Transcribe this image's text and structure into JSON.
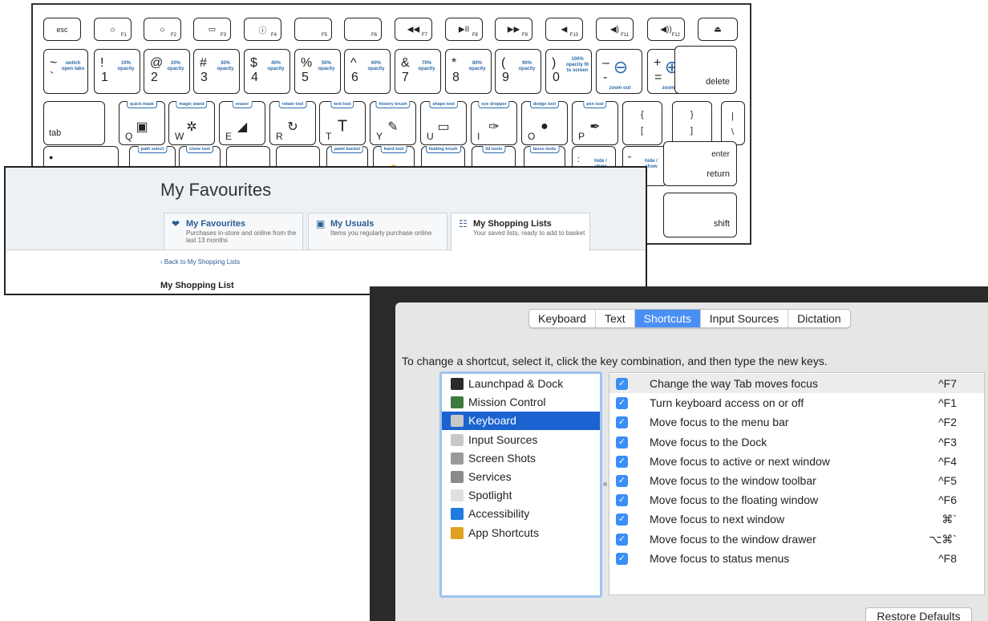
{
  "keyboard": {
    "row1": [
      {
        "label": "esc",
        "fn": ""
      },
      {
        "label": "☼",
        "fn": "F1"
      },
      {
        "label": "☼",
        "fn": "F2"
      },
      {
        "label": "▭",
        "fn": "F3"
      },
      {
        "label": "ⓘ",
        "fn": "F4"
      },
      {
        "label": "",
        "fn": "F5"
      },
      {
        "label": "",
        "fn": "F6"
      },
      {
        "label": "◀◀",
        "fn": "F7"
      },
      {
        "label": "▶II",
        "fn": "F8"
      },
      {
        "label": "▶▶",
        "fn": "F9"
      },
      {
        "label": "◀",
        "fn": "F10"
      },
      {
        "label": "◀)",
        "fn": "F11"
      },
      {
        "label": "◀))",
        "fn": "F12"
      },
      {
        "label": "⏏",
        "fn": ""
      }
    ],
    "row2": [
      {
        "sym": "~",
        "base": "`",
        "action": "switch open tabs"
      },
      {
        "sym": "!",
        "base": "1",
        "action": "10% opacity"
      },
      {
        "sym": "@",
        "base": "2",
        "action": "20% opacity"
      },
      {
        "sym": "#",
        "base": "3",
        "action": "30% opacity"
      },
      {
        "sym": "$",
        "base": "4",
        "action": "40% opacity"
      },
      {
        "sym": "%",
        "base": "5",
        "action": "50% opacity"
      },
      {
        "sym": "^",
        "base": "6",
        "action": "60% opacity"
      },
      {
        "sym": "&",
        "base": "7",
        "action": "70% opacity"
      },
      {
        "sym": "*",
        "base": "8",
        "action": "80% opacity"
      },
      {
        "sym": "(",
        "base": "9",
        "action": "90% opacity"
      },
      {
        "sym": ")",
        "base": "0",
        "action": "100% opacity fit to screen"
      },
      {
        "sym": "–",
        "base": "-",
        "action": "zoom out"
      },
      {
        "sym": "+",
        "base": "=",
        "action": "zoom in"
      },
      {
        "sym": "",
        "base": "delete",
        "action": ""
      }
    ],
    "row3": [
      {
        "base": "tab",
        "tool": ""
      },
      {
        "base": "Q",
        "tool": "quick mask"
      },
      {
        "base": "W",
        "tool": "magic wand"
      },
      {
        "base": "E",
        "tool": "eraser"
      },
      {
        "base": "R",
        "tool": "rotate tool"
      },
      {
        "base": "T",
        "tool": "text tool"
      },
      {
        "base": "Y",
        "tool": "history brush"
      },
      {
        "base": "U",
        "tool": "shape tool"
      },
      {
        "base": "I",
        "tool": "eye dropper"
      },
      {
        "base": "O",
        "tool": "dodge tool"
      },
      {
        "base": "P",
        "tool": "pen tool"
      },
      {
        "base": "{ [",
        "tool": ""
      },
      {
        "base": "} ]",
        "tool": ""
      },
      {
        "base": "| \\",
        "tool": ""
      }
    ],
    "row4": [
      {
        "base": "●",
        "tool": ""
      },
      {
        "base": "",
        "tool": "path select"
      },
      {
        "base": "",
        "tool": "clone tool"
      },
      {
        "base": "",
        "tool": ""
      },
      {
        "base": "",
        "tool": ""
      },
      {
        "base": "",
        "tool": "paint bucket"
      },
      {
        "base": "",
        "tool": "hand tool"
      },
      {
        "base": "",
        "tool": "healing brush"
      },
      {
        "base": "",
        "tool": "3d tools"
      },
      {
        "base": "",
        "tool": "lasso tools"
      },
      {
        "base": ":",
        "tool": "hide / show"
      },
      {
        "base": "\"",
        "tool": "hide / show"
      }
    ],
    "enter_top": "enter",
    "enter_bottom": "return",
    "shift": "shift"
  },
  "favourites": {
    "title": "My Favourites",
    "tabs": [
      {
        "title": "My Favourites",
        "subtitle": "Purchases in-store and online from the last 13 months",
        "icon": "heart-icon"
      },
      {
        "title": "My Usuals",
        "subtitle": "Items you regularly purchase online",
        "icon": "basket-icon"
      },
      {
        "title": "My Shopping Lists",
        "subtitle": "Your saved lists, ready to add to basket",
        "icon": "list-icon"
      }
    ],
    "back_link": "‹ Back to My Shopping Lists",
    "list_title": "My Shopping List"
  },
  "prefs": {
    "tabs": [
      "Keyboard",
      "Text",
      "Shortcuts",
      "Input Sources",
      "Dictation"
    ],
    "selected_tab": "Shortcuts",
    "instruction": "To change a shortcut, select it, click the key combination, and then type the new keys.",
    "categories": [
      {
        "label": "Launchpad & Dock",
        "icon": "dock-icon",
        "color": "#2b2b2b"
      },
      {
        "label": "Mission Control",
        "icon": "mission-control-icon",
        "color": "#3d7a3d"
      },
      {
        "label": "Keyboard",
        "icon": "keyboard-icon",
        "color": "#c8c8c8"
      },
      {
        "label": "Input Sources",
        "icon": "input-sources-icon",
        "color": "#c8c8c8"
      },
      {
        "label": "Screen Shots",
        "icon": "screenshot-icon",
        "color": "#9a9a9a"
      },
      {
        "label": "Services",
        "icon": "gear-icon",
        "color": "#8a8a8a"
      },
      {
        "label": "Spotlight",
        "icon": "spotlight-icon",
        "color": "#e0e0e0"
      },
      {
        "label": "Accessibility",
        "icon": "accessibility-icon",
        "color": "#1f7bdc"
      },
      {
        "label": "App Shortcuts",
        "icon": "app-shortcuts-icon",
        "color": "#e0a020"
      }
    ],
    "selected_category": "Keyboard",
    "shortcuts": [
      {
        "label": "Change the way Tab moves focus",
        "keys": "^F7",
        "checked": true
      },
      {
        "label": "Turn keyboard access on or off",
        "keys": "^F1",
        "checked": true
      },
      {
        "label": "Move focus to the menu bar",
        "keys": "^F2",
        "checked": true
      },
      {
        "label": "Move focus to the Dock",
        "keys": "^F3",
        "checked": true
      },
      {
        "label": "Move focus to active or next window",
        "keys": "^F4",
        "checked": true
      },
      {
        "label": "Move focus to the window toolbar",
        "keys": "^F5",
        "checked": true
      },
      {
        "label": "Move focus to the floating window",
        "keys": "^F6",
        "checked": true
      },
      {
        "label": "Move focus to next window",
        "keys": "⌘`",
        "checked": true
      },
      {
        "label": "Move focus to the window drawer",
        "keys": "⌥⌘`",
        "checked": true
      },
      {
        "label": "Move focus to status menus",
        "keys": "^F8",
        "checked": true
      }
    ],
    "restore_button": "Restore Defaults"
  }
}
